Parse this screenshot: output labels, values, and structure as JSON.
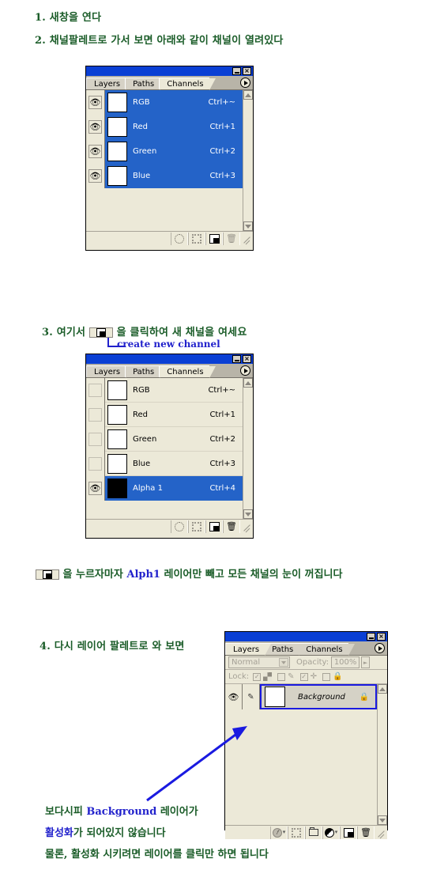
{
  "doc": {
    "steps": [
      {
        "n": "1.",
        "text": "새창을 연다"
      },
      {
        "n": "2.",
        "text": "채널팔레트로 가서 보면 아래와 같이 채널이 열려있다"
      },
      {
        "n": "3.",
        "pre": "여기서",
        "post": "을 클릭하여 새 채널을 여세요"
      },
      {
        "n": "4.",
        "text": "다시 레이어 팔레트로 와 보면"
      }
    ],
    "callout_create": "create new channel",
    "note_line": {
      "pre": "을 누르자마자",
      "highlight": "Alph1",
      "post": "레이어만 빼고 모든 채널의 눈이 꺼집니다"
    },
    "bottom_note": {
      "line1_a": "보다시피",
      "line1_b": "Background",
      "line1_c": "레이어가",
      "line2_a": "활성화",
      "line2_b": "가 되어있지 않습니다",
      "line3": "물론, 활성화 시키려면 레이어를 클릭만 하면 됩니다"
    },
    "colors": {
      "text_green": "#1a5c28",
      "text_blue": "#2222cc",
      "selection_blue": "#2463c8",
      "titlebar_blue": "#0a3fd4",
      "palette_bg": "#ece9d8",
      "highlight_border": "#1a1ae0"
    }
  },
  "palette_channels_before": {
    "titlebar": {
      "minimize": "minimize-button",
      "close": "×"
    },
    "tabs": [
      {
        "label": "Layers",
        "active": false
      },
      {
        "label": "Paths",
        "active": false
      },
      {
        "label": "Channels",
        "active": true
      }
    ],
    "menu_arrow": "palette-menu-arrow",
    "rows": [
      {
        "name": "RGB",
        "shortcut": "Ctrl+~",
        "visible": true,
        "selected": true,
        "thumb": "white"
      },
      {
        "name": "Red",
        "shortcut": "Ctrl+1",
        "visible": true,
        "selected": true,
        "thumb": "white"
      },
      {
        "name": "Green",
        "shortcut": "Ctrl+2",
        "visible": true,
        "selected": true,
        "thumb": "white"
      },
      {
        "name": "Blue",
        "shortcut": "Ctrl+3",
        "visible": true,
        "selected": true,
        "thumb": "white"
      }
    ],
    "footer_buttons": [
      "load-channel-as-selection",
      "save-selection-as-channel",
      "create-new-channel",
      "delete-channel"
    ]
  },
  "palette_channels_after": {
    "tabs": [
      {
        "label": "Layers",
        "active": false
      },
      {
        "label": "Paths",
        "active": false
      },
      {
        "label": "Channels",
        "active": true
      }
    ],
    "rows": [
      {
        "name": "RGB",
        "shortcut": "Ctrl+~",
        "visible": false,
        "selected": false,
        "thumb": "white"
      },
      {
        "name": "Red",
        "shortcut": "Ctrl+1",
        "visible": false,
        "selected": false,
        "thumb": "white"
      },
      {
        "name": "Green",
        "shortcut": "Ctrl+2",
        "visible": false,
        "selected": false,
        "thumb": "white"
      },
      {
        "name": "Blue",
        "shortcut": "Ctrl+3",
        "visible": false,
        "selected": false,
        "thumb": "white"
      },
      {
        "name": "Alpha 1",
        "shortcut": "Ctrl+4",
        "visible": true,
        "selected": true,
        "thumb": "black"
      }
    ]
  },
  "palette_layers": {
    "tabs": [
      {
        "label": "Layers",
        "active": true
      },
      {
        "label": "Paths",
        "active": false
      },
      {
        "label": "Channels",
        "active": false
      }
    ],
    "blend_mode": "Normal",
    "opacity_label": "Opacity:",
    "opacity_value": "100%",
    "lock_label": "Lock:",
    "lock_toggles": [
      {
        "name": "lock-transparent-pixels",
        "checked": true
      },
      {
        "name": "lock-image-pixels",
        "checked": false
      },
      {
        "name": "lock-position",
        "checked": true
      },
      {
        "name": "lock-all",
        "checked": false
      }
    ],
    "rows": [
      {
        "name": "Background",
        "visible": true,
        "brush": true,
        "locked": true,
        "selected": false,
        "outlined": true
      }
    ],
    "footer_buttons": [
      "add-layer-style",
      "add-layer-mask",
      "create-new-group",
      "create-new-fill-or-adjustment-layer",
      "create-new-layer",
      "delete-layer"
    ]
  }
}
